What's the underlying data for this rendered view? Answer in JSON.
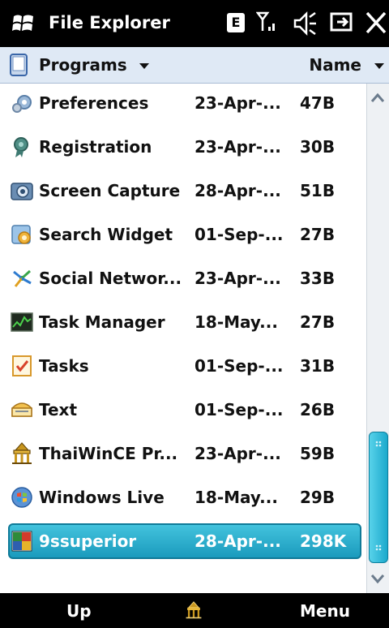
{
  "titlebar": {
    "app_title": "File Explorer",
    "status_icons": [
      "e-data-icon",
      "signal-icon",
      "volume-muted-icon",
      "connectivity-icon",
      "close-icon"
    ],
    "data_badge": "E"
  },
  "folderbar": {
    "folder": "Programs",
    "sort_by": "Name"
  },
  "files": [
    {
      "name": "Preferences",
      "date": "23-Apr-...",
      "size": "47B",
      "icon": "preferences-icon"
    },
    {
      "name": "Registration",
      "date": "23-Apr-...",
      "size": "30B",
      "icon": "registration-icon"
    },
    {
      "name": "Screen Capture",
      "date": "28-Apr-...",
      "size": "51B",
      "icon": "camera-icon"
    },
    {
      "name": "Search Widget",
      "date": "01-Sep-...",
      "size": "27B",
      "icon": "search-widget-icon"
    },
    {
      "name": "Social Networ...",
      "date": "23-Apr-...",
      "size": "33B",
      "icon": "social-network-icon"
    },
    {
      "name": "Task Manager",
      "date": "18-May...",
      "size": "27B",
      "icon": "task-manager-icon"
    },
    {
      "name": "Tasks",
      "date": "01-Sep-...",
      "size": "31B",
      "icon": "tasks-icon"
    },
    {
      "name": "Text",
      "date": "01-Sep-...",
      "size": "26B",
      "icon": "text-message-icon"
    },
    {
      "name": "ThaiWinCE Pr...",
      "date": "23-Apr-...",
      "size": "59B",
      "icon": "thai-temple-icon"
    },
    {
      "name": "Windows Live",
      "date": "18-May...",
      "size": "29B",
      "icon": "windows-live-icon"
    },
    {
      "name": "9ssuperior",
      "date": "28-Apr-...",
      "size": "298K",
      "icon": "app-icon",
      "selected": true
    }
  ],
  "softkeys": {
    "left": "Up",
    "center_icon": "thai-temple-icon",
    "right": "Menu"
  },
  "colors": {
    "titlebar": "#000000",
    "folderbar": "#dfe9f5",
    "selection": "#1a9bbd"
  }
}
